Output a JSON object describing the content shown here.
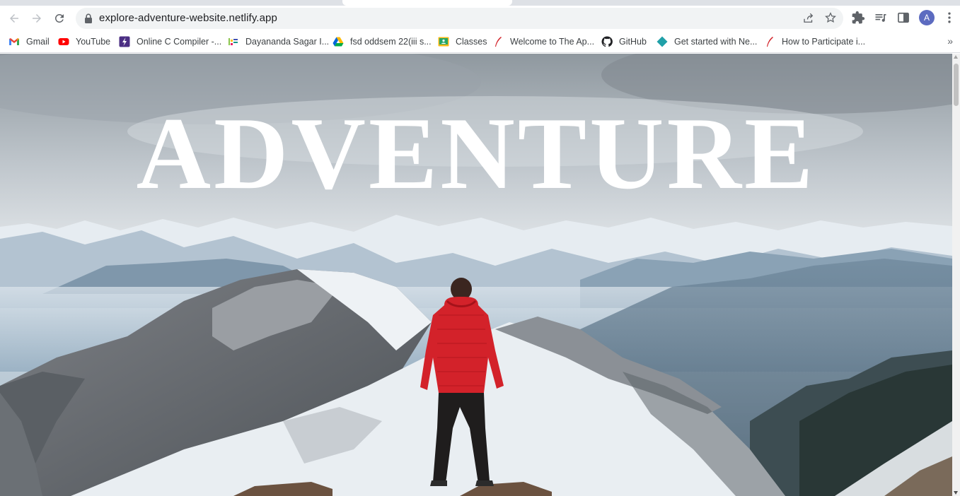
{
  "browser": {
    "url": "explore-adventure-website.netlify.app",
    "profile_initial": "A",
    "icons": {
      "back": "arrow-left-icon",
      "forward": "arrow-right-icon",
      "reload": "reload-icon",
      "lock": "lock-icon",
      "share": "share-icon",
      "bookmark": "star-icon",
      "extensions": "puzzle-icon",
      "media": "media-queue-icon",
      "side_panel": "side-panel-icon",
      "menu": "kebab-menu-icon"
    }
  },
  "bookmarks": [
    {
      "label": "Gmail",
      "icon": "gmail-icon"
    },
    {
      "label": "YouTube",
      "icon": "youtube-icon"
    },
    {
      "label": "Online C Compiler -...",
      "icon": "compiler-icon"
    },
    {
      "label": "Dayananda Sagar I...",
      "icon": "college-icon"
    },
    {
      "label": "fsd oddsem 22(iii s...",
      "icon": "google-drive-icon"
    },
    {
      "label": "Classes",
      "icon": "classroom-icon"
    },
    {
      "label": "Welcome to The Ap...",
      "icon": "feather-icon"
    },
    {
      "label": "GitHub",
      "icon": "github-icon"
    },
    {
      "label": "Get started with Ne...",
      "icon": "netlify-icon"
    },
    {
      "label": "How to Participate i...",
      "icon": "feather-icon"
    }
  ],
  "page": {
    "hero_title": "ADVENTURE",
    "background": "mountain-summit-hiker-photo",
    "colors": {
      "title": "#ffffff",
      "jacket": "#d3222a",
      "sky": "#c9cfd5"
    }
  }
}
